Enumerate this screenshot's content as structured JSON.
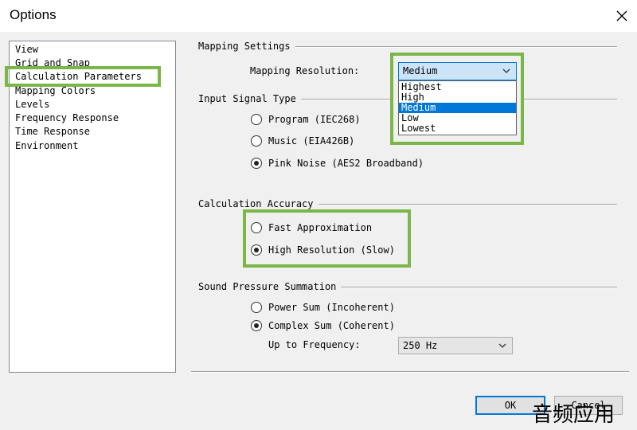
{
  "window": {
    "title": "Options"
  },
  "sidebar": {
    "items": [
      {
        "label": "View"
      },
      {
        "label": "Grid and Snap"
      },
      {
        "label": "Calculation Parameters"
      },
      {
        "label": "Mapping Colors"
      },
      {
        "label": "Levels"
      },
      {
        "label": "Frequency Response"
      },
      {
        "label": "Time Response"
      },
      {
        "label": "Environment"
      }
    ],
    "selected": "Calculation Parameters"
  },
  "mapping_settings": {
    "heading": "Mapping Settings",
    "resolution_label": "Mapping Resolution:",
    "resolution_value": "Medium",
    "resolution_options": [
      "Highest",
      "High",
      "Medium",
      "Low",
      "Lowest"
    ],
    "highlighted_option": "Medium"
  },
  "input_signal": {
    "heading": "Input Signal Type",
    "options": [
      {
        "label": "Program (IEC268)",
        "checked": false
      },
      {
        "label": "Music (EIA426B)",
        "checked": false
      },
      {
        "label": "Pink Noise (AES2 Broadband)",
        "checked": true
      }
    ]
  },
  "accuracy": {
    "heading": "Calculation Accuracy",
    "options": [
      {
        "label": "Fast Approximation",
        "checked": false
      },
      {
        "label": "High Resolution (Slow)",
        "checked": true
      }
    ]
  },
  "summation": {
    "heading": "Sound Pressure Summation",
    "options": [
      {
        "label": "Power Sum (Incoherent)",
        "checked": false
      },
      {
        "label": "Complex Sum (Coherent)",
        "checked": true
      }
    ],
    "frequency_label": "Up to Frequency:",
    "frequency_value": "250 Hz"
  },
  "buttons": {
    "ok": "OK",
    "cancel": "Cancel"
  },
  "watermark": {
    "text": "音频应用"
  },
  "colors": {
    "highlight_box": "#7ab648",
    "selection": "#0078d7",
    "combo_focus": "#cce4f7"
  }
}
